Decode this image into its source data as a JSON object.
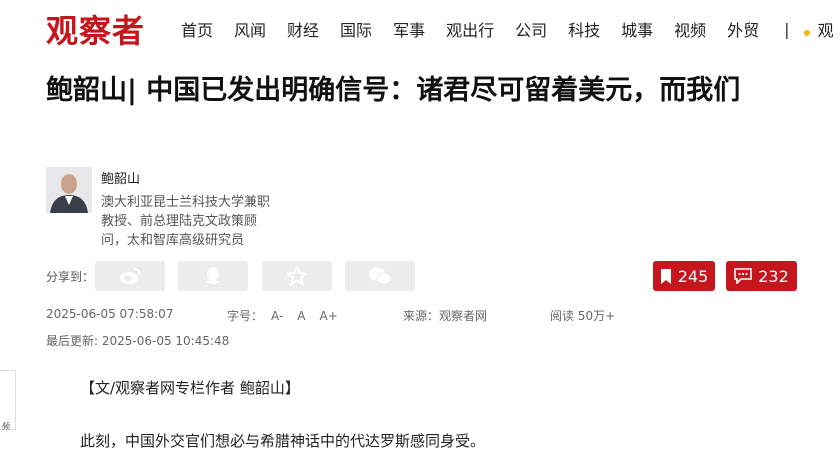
{
  "header": {
    "logo": "观察者",
    "nav": [
      "首页",
      "风闻",
      "财经",
      "国际",
      "军事",
      "观出行",
      "公司",
      "科技",
      "城事",
      "视频",
      "外贸"
    ],
    "separator": "|",
    "more_text": "观"
  },
  "article": {
    "title": "鲍韶山| 中国已发出明确信号：诸君尽可留着美元，而我们",
    "author": {
      "name": "鲍韶山",
      "description": "澳大利亚昆士兰科技大学兼职教授、前总理陆克文政策顾问，太和智库高级研究员"
    },
    "share_label": "分享到：",
    "share_icons": [
      "weibo-icon",
      "qq-icon",
      "star-icon",
      "wechat-icon"
    ],
    "bookmark_count": "245",
    "comment_count": "232",
    "meta": {
      "published": "2025-06-05 07:58:07",
      "font_label": "字号：",
      "font_small": "A-",
      "font_normal": "A",
      "font_large": "A+",
      "source_label": "来源：",
      "source": "观察者网",
      "reads_label": "阅读",
      "reads": "50万+",
      "updated": "最后更新: 2025-06-05 10:45:48"
    },
    "paragraphs": [
      "【文/观察者网专栏作者 鲍韶山】",
      "此刻，中国外交官们想必与希腊神话中的代达罗斯感同身受。"
    ],
    "side_tab_text": "频"
  },
  "colors": {
    "brand": "#c4161c",
    "share_bg": "#ececec"
  }
}
